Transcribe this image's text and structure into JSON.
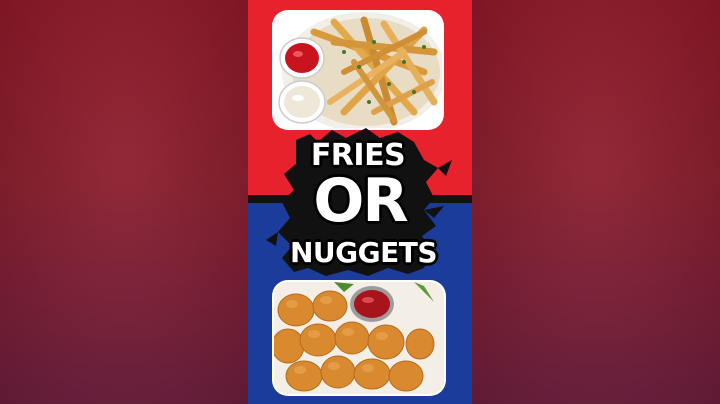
{
  "thumbnail": {
    "words": {
      "top": "FRIES",
      "middle": "OR",
      "bottom": "NUGGETS"
    },
    "colors": {
      "top_half": "#e8222c",
      "bottom_half": "#1c3c9c",
      "side_background": "#8a1c2c"
    },
    "images": {
      "top": "fries-photo",
      "bottom": "nuggets-photo"
    }
  }
}
